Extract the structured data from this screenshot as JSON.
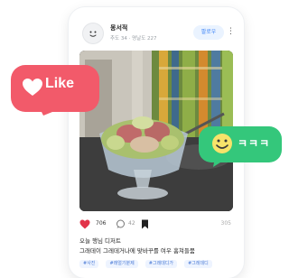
{
  "post": {
    "author": {
      "name": "몽서적",
      "meta": "추도 34 · 명날도 227"
    },
    "follow_label": "팔로우",
    "more_label": "⋮",
    "likes": "706",
    "comments": "42",
    "views": "305",
    "caption_line1": "오늘 행님 디저트",
    "caption_line2": "그래데이 그레데거나에 맞바꾸를 여우 훔쳐들뭄",
    "tags": [
      "#사진",
      "#래얼기분제",
      "#그레데디가",
      "#그레데디"
    ]
  },
  "overlays": {
    "like_label": "Like",
    "lol_label": "ㅋㅋㅋ"
  },
  "colors": {
    "like_bubble": "#f25a6a",
    "lol_bubble": "#34c77b",
    "like_heart": "#e2344a",
    "follow_text": "#3b82f6"
  },
  "icons": [
    "avatar-face-icon",
    "heart-icon",
    "comment-icon",
    "bookmark-icon",
    "more-icon",
    "smile-emoji-icon"
  ]
}
